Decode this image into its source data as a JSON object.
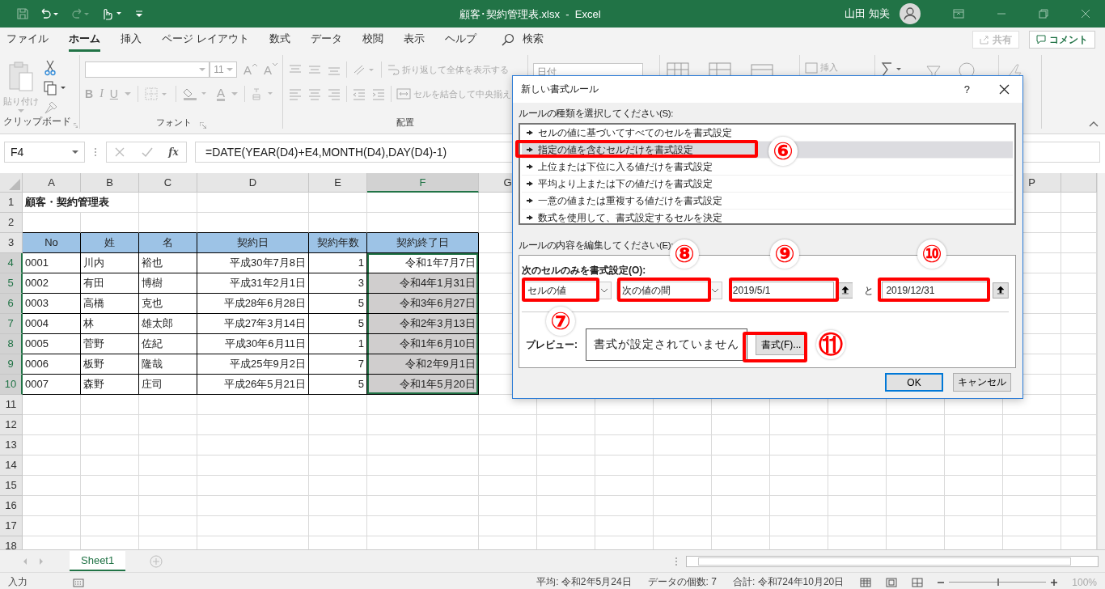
{
  "title_bar": {
    "title": "顧客･契約管理表.xlsx  -  Excel",
    "user": "山田 知美"
  },
  "ribbon_tabs": [
    {
      "label": "ファイル",
      "selected": false
    },
    {
      "label": "ホーム",
      "selected": true
    },
    {
      "label": "挿入",
      "selected": false
    },
    {
      "label": "ページ レイアウト",
      "selected": false
    },
    {
      "label": "数式",
      "selected": false
    },
    {
      "label": "データ",
      "selected": false
    },
    {
      "label": "校閲",
      "selected": false
    },
    {
      "label": "表示",
      "selected": false
    },
    {
      "label": "ヘルプ",
      "selected": false
    }
  ],
  "search": {
    "label": "検索"
  },
  "share": {
    "share": "共有",
    "comment": "コメント"
  },
  "ribbon": {
    "paste": "貼り付け",
    "font_size": "11",
    "grow": "A",
    "shrink": "A",
    "bold": "B",
    "italic": "I",
    "underline": "U",
    "font_color": "A",
    "wrap": "折り返して全体を表示する",
    "merge": "セルを結合して中央揃え",
    "number_format": "日付",
    "insert": "挿入",
    "groups": [
      "クリップボード",
      "フォント",
      "配置"
    ]
  },
  "formula_bar": {
    "name_box": "F4",
    "fx": "fx",
    "formula": "=DATE(YEAR(D4)+E4,MONTH(D4),DAY(D4)-1)"
  },
  "sheet": {
    "columns": [
      "A",
      "B",
      "C",
      "D",
      "E",
      "F",
      "G",
      "P"
    ],
    "row_numbers": [
      "1",
      "2",
      "3",
      "4",
      "5",
      "6",
      "7",
      "8",
      "9",
      "10",
      "11",
      "12",
      "13",
      "14",
      "15",
      "16",
      "17",
      "18"
    ],
    "title": "顧客・契約管理表",
    "header": [
      "No",
      "姓",
      "名",
      "契約日",
      "契約年数",
      "契約終了日"
    ],
    "rows": [
      {
        "cells": [
          "0001",
          "川内",
          "裕也",
          "平成30年7月8日",
          "1",
          "令和1年7月7日"
        ],
        "selected": true,
        "active": true
      },
      {
        "cells": [
          "0002",
          "有田",
          "博樹",
          "平成31年2月1日",
          "3",
          "令和4年1月31日"
        ],
        "selected": true,
        "active": false
      },
      {
        "cells": [
          "0003",
          "高橋",
          "克也",
          "平成28年6月28日",
          "5",
          "令和3年6月27日"
        ],
        "selected": true,
        "active": false
      },
      {
        "cells": [
          "0004",
          "林",
          "雄太郎",
          "平成27年3月14日",
          "5",
          "令和2年3月13日"
        ],
        "selected": true,
        "active": false
      },
      {
        "cells": [
          "0005",
          "菅野",
          "佐紀",
          "平成30年6月11日",
          "1",
          "令和1年6月10日"
        ],
        "selected": true,
        "active": false
      },
      {
        "cells": [
          "0006",
          "板野",
          "隆哉",
          "平成25年9月2日",
          "7",
          "令和2年9月1日"
        ],
        "selected": true,
        "active": false
      },
      {
        "cells": [
          "0007",
          "森野",
          "庄司",
          "平成26年5月21日",
          "5",
          "令和1年5月20日"
        ],
        "selected": true,
        "active": false
      }
    ]
  },
  "sheet_tabs": [
    {
      "label": "Sheet1",
      "selected": true
    }
  ],
  "status_bar": {
    "mode": "入力",
    "average": "平均: 令和2年5月24日",
    "count": "データの個数: 7",
    "sum": "合計: 令和724年10月20日",
    "zoom": "100%",
    "zoom_slider": {
      "level": 0.5
    }
  },
  "dialog": {
    "title": "新しい書式ルール",
    "help": "?",
    "rule_types_label": "ルールの種類を選択してください(S):",
    "rule_types": [
      {
        "label": "セルの値に基づいてすべてのセルを書式設定",
        "selected": false
      },
      {
        "label": "指定の値を含むセルだけを書式設定",
        "selected": true
      },
      {
        "label": "上位または下位に入る値だけを書式設定",
        "selected": false
      },
      {
        "label": "平均より上または下の値だけを書式設定",
        "selected": false
      },
      {
        "label": "一意の値または重複する値だけを書式設定",
        "selected": false
      },
      {
        "label": "数式を使用して、書式設定するセルを決定",
        "selected": false
      }
    ],
    "edit_label": "ルールの内容を編集してください(E):",
    "condition_label": "次のセルのみを書式設定(O):",
    "condition_type": "セルの値",
    "operator": "次の値の間",
    "value_1": "2019/5/1",
    "and": "と",
    "value_2": "2019/12/31",
    "preview_label": "プレビュー:",
    "preview": "書式が設定されていません",
    "format_button": "書式(F)...",
    "ok": "OK",
    "cancel": "キャンセル"
  },
  "annotations": [
    {
      "kind": "box"
    },
    {
      "kind": "box"
    },
    {
      "kind": "box"
    },
    {
      "kind": "box"
    },
    {
      "kind": "box"
    },
    {
      "kind": "box"
    },
    {
      "kind": "badge",
      "label": "⑥"
    },
    {
      "kind": "badge",
      "label": "⑦"
    },
    {
      "kind": "badge",
      "label": "⑧"
    },
    {
      "kind": "badge",
      "label": "⑨"
    },
    {
      "kind": "badge",
      "label": "⑩"
    },
    {
      "kind": "badge",
      "label": "⑪"
    }
  ]
}
